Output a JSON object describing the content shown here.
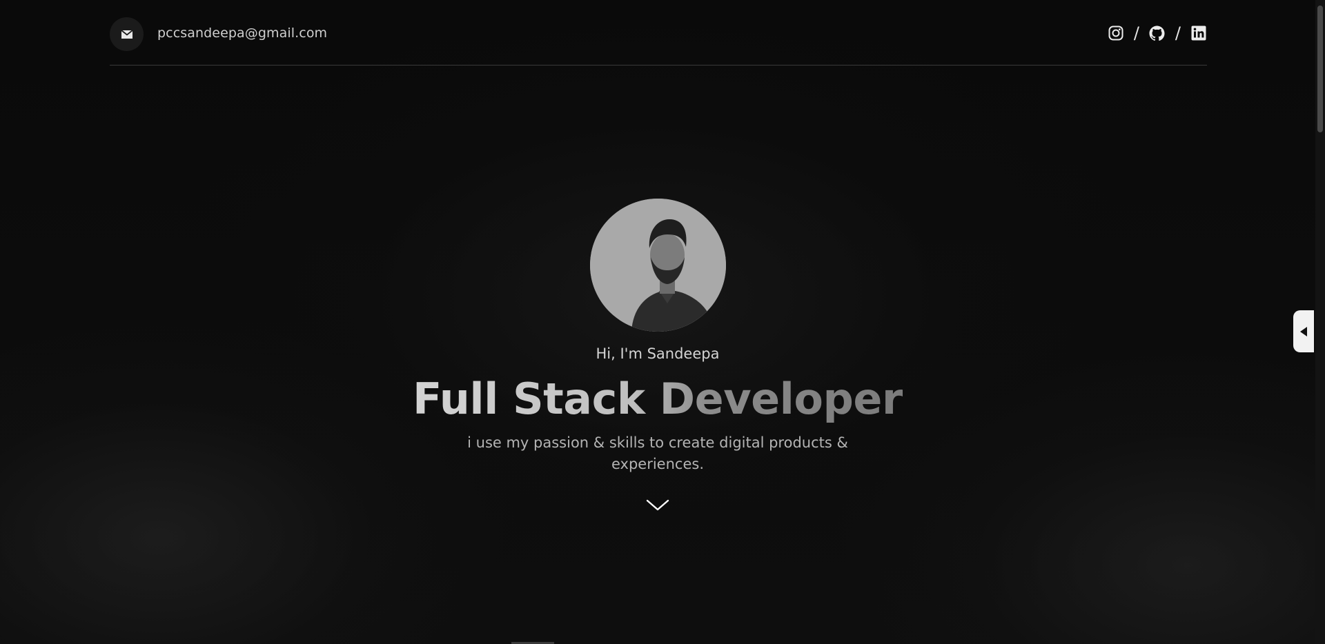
{
  "header": {
    "email": "pccsandeepa@gmail.com",
    "mail_icon": "envelope-icon",
    "socials": [
      {
        "name": "instagram-icon"
      },
      {
        "name": "github-icon"
      },
      {
        "name": "linkedin-icon"
      }
    ],
    "separator": "/"
  },
  "hero": {
    "greeting": "Hi, I'm Sandeepa",
    "title": "Full Stack Developer",
    "subtitle": "i use my passion & skills to create digital products & experiences.",
    "scroll_icon": "chevron-down-icon"
  },
  "side": {
    "toggle_icon": "caret-left-icon"
  },
  "colors": {
    "background": "#0b0b0b",
    "text": "#d8d8d8",
    "accent": "#f2f2f2"
  }
}
